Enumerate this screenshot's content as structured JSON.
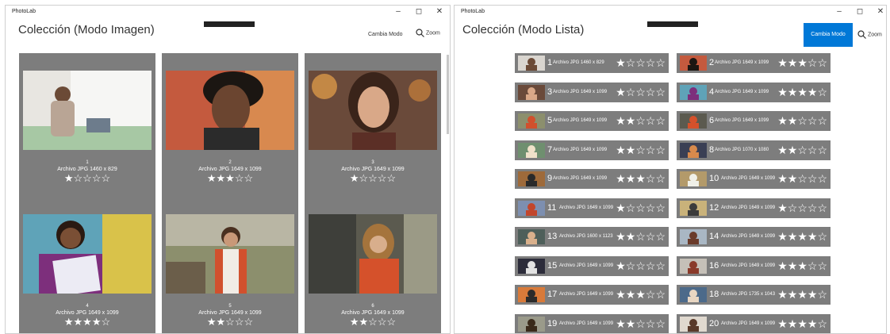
{
  "left": {
    "app_title": "PhotoLab",
    "page_title": "Colección (Modo Imagen)",
    "cambia_modo": "Cambia Modo",
    "zoom": "Zoom",
    "photos": [
      {
        "num": "1",
        "meta": "Archivo JPG  1460 x 829",
        "rating": 1,
        "stars": "★☆☆☆☆"
      },
      {
        "num": "2",
        "meta": "Archivo JPG  1649 x 1099",
        "rating": 3,
        "stars": "★★★☆☆"
      },
      {
        "num": "3",
        "meta": "Archivo JPG  1649 x 1099",
        "rating": 1,
        "stars": "★☆☆☆☆"
      },
      {
        "num": "4",
        "meta": "Archivo JPG  1649 x 1099",
        "rating": 4,
        "stars": "★★★★☆"
      },
      {
        "num": "5",
        "meta": "Archivo JPG  1649 x 1099",
        "rating": 2,
        "stars": "★★☆☆☆"
      },
      {
        "num": "6",
        "meta": "Archivo JPG  1649 x 1099",
        "rating": 2,
        "stars": "★★☆☆☆"
      }
    ]
  },
  "right": {
    "app_title": "PhotoLab",
    "page_title": "Colección (Modo Lista)",
    "cambia_modo": "Cambia Modo",
    "zoom": "Zoom",
    "items": [
      {
        "num": "1",
        "meta": "Archivo JPG   1460 x 829",
        "rating": 1,
        "stars": "★☆☆☆☆"
      },
      {
        "num": "2",
        "meta": "Archivo JPG   1649 x 1099",
        "rating": 3,
        "stars": "★★★☆☆"
      },
      {
        "num": "3",
        "meta": "Archivo JPG   1649 x 1099",
        "rating": 1,
        "stars": "★☆☆☆☆"
      },
      {
        "num": "4",
        "meta": "Archivo JPG   1649 x 1099",
        "rating": 4,
        "stars": "★★★★☆"
      },
      {
        "num": "5",
        "meta": "Archivo JPG   1649 x 1099",
        "rating": 2,
        "stars": "★★☆☆☆"
      },
      {
        "num": "6",
        "meta": "Archivo JPG   1649 x 1099",
        "rating": 2,
        "stars": "★★☆☆☆"
      },
      {
        "num": "7",
        "meta": "Archivo JPG   1649 x 1099",
        "rating": 2,
        "stars": "★★☆☆☆"
      },
      {
        "num": "8",
        "meta": "Archivo JPG   1070 x 1080",
        "rating": 2,
        "stars": "★★☆☆☆"
      },
      {
        "num": "9",
        "meta": "Archivo JPG   1649 x 1099",
        "rating": 3,
        "stars": "★★★☆☆"
      },
      {
        "num": "10",
        "meta": "Archivo JPG   1649 x 1099",
        "rating": 2,
        "stars": "★★☆☆☆"
      },
      {
        "num": "11",
        "meta": "Archivo JPG   1649 x 1099",
        "rating": 1,
        "stars": "★☆☆☆☆"
      },
      {
        "num": "12",
        "meta": "Archivo JPG   1649 x 1099",
        "rating": 1,
        "stars": "★☆☆☆☆"
      },
      {
        "num": "13",
        "meta": "Archivo JPG   1600 x 1123",
        "rating": 2,
        "stars": "★★☆☆☆"
      },
      {
        "num": "14",
        "meta": "Archivo JPG   1649 x 1099",
        "rating": 4,
        "stars": "★★★★☆"
      },
      {
        "num": "15",
        "meta": "Archivo JPG   1649 x 1099",
        "rating": 1,
        "stars": "★☆☆☆☆"
      },
      {
        "num": "16",
        "meta": "Archivo JPG   1649 x 1099",
        "rating": 3,
        "stars": "★★★☆☆"
      },
      {
        "num": "17",
        "meta": "Archivo JPG   1649 x 1099",
        "rating": 3,
        "stars": "★★★☆☆"
      },
      {
        "num": "18",
        "meta": "Archivo JPG   1735 x 1043",
        "rating": 4,
        "stars": "★★★★☆"
      },
      {
        "num": "19",
        "meta": "Archivo JPG   1649 x 1099",
        "rating": 2,
        "stars": "★★☆☆☆"
      },
      {
        "num": "20",
        "meta": "Archivo JPG   1649 x 1099",
        "rating": 4,
        "stars": "★★★★☆"
      }
    ]
  },
  "colors": {
    "accent": "#0078d7",
    "card_bg": "#7d7d7d"
  },
  "icons": {
    "minimize": "minimize-icon",
    "maximize": "maximize-icon",
    "close": "close-icon",
    "zoom": "search-icon"
  }
}
